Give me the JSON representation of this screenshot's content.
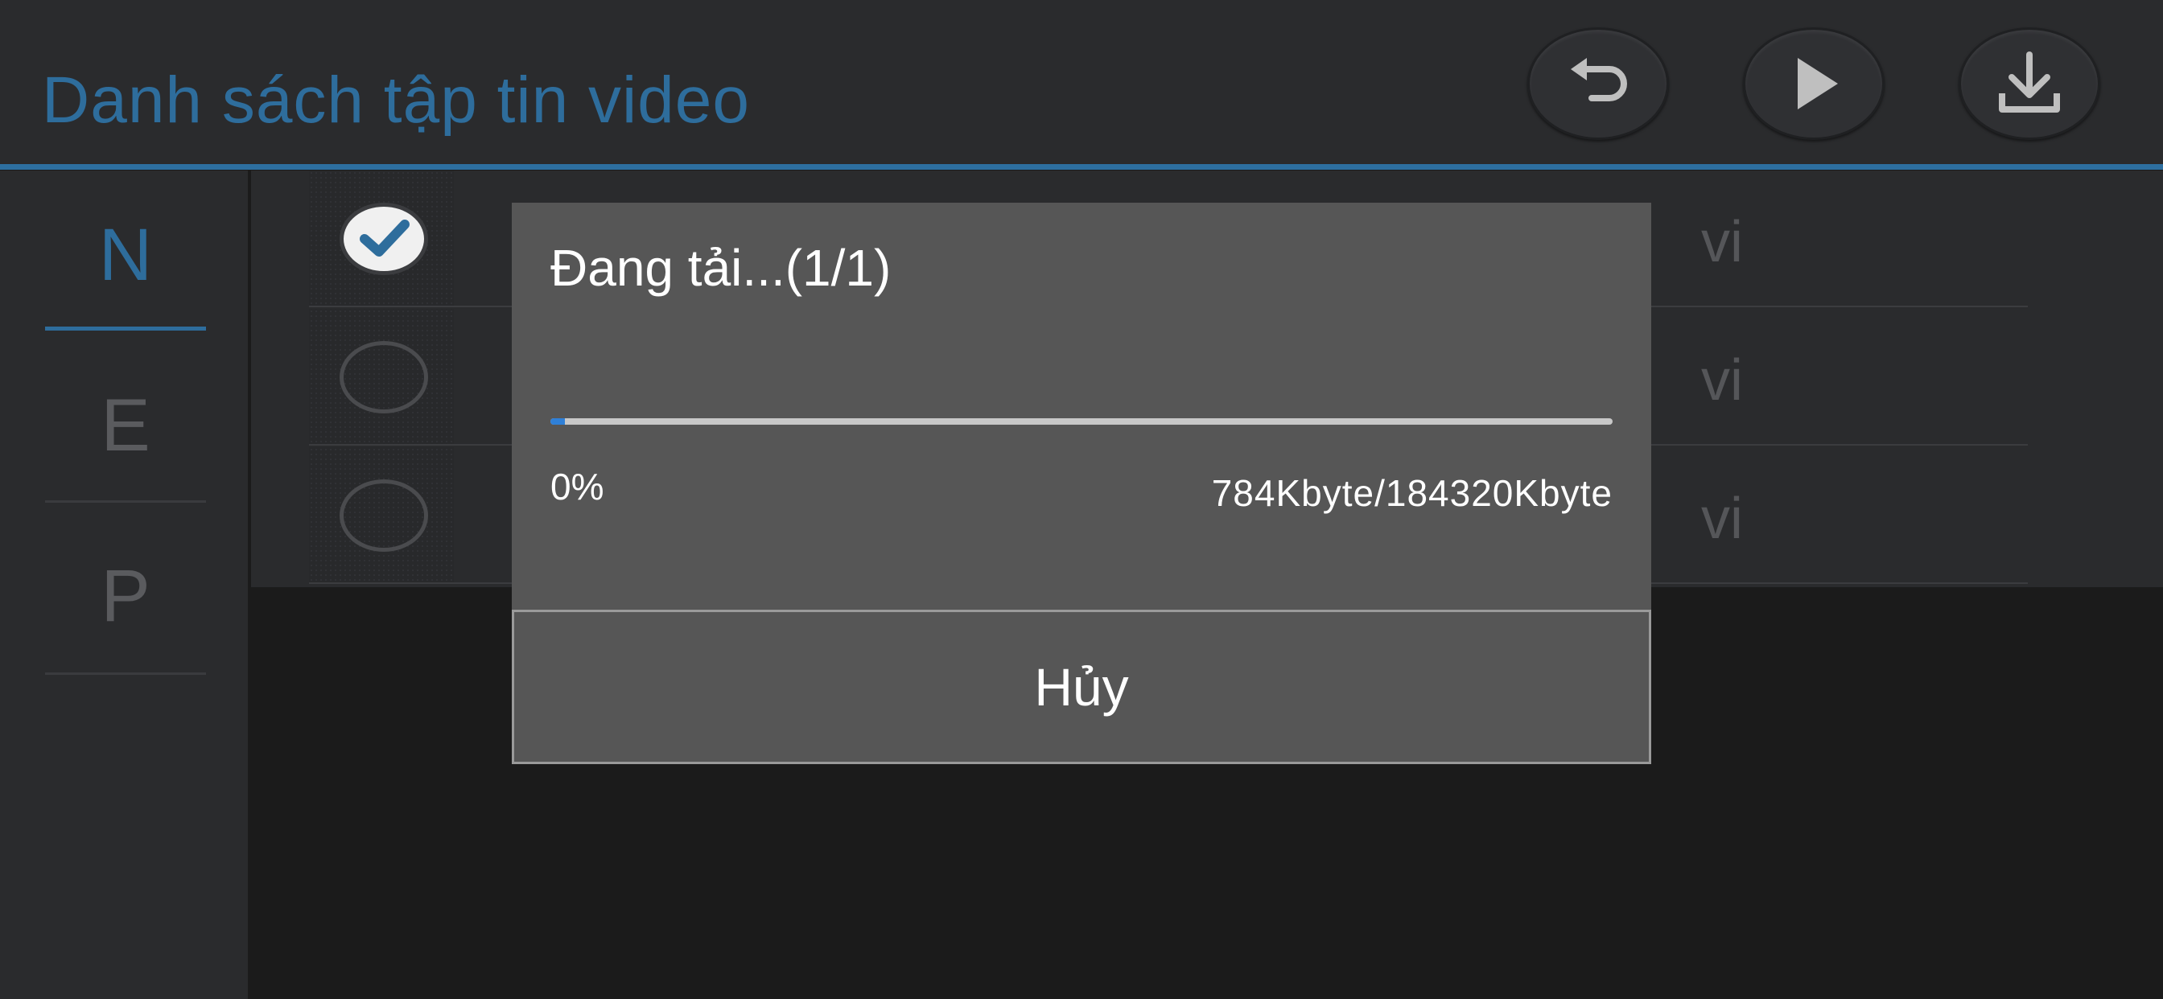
{
  "header": {
    "title": "Danh sách tập tin video",
    "buttons": [
      {
        "icon": "back-arrow-icon"
      },
      {
        "icon": "play-icon"
      },
      {
        "icon": "download-icon"
      }
    ]
  },
  "sidebar": {
    "items": [
      {
        "label": "N",
        "active": true
      },
      {
        "label": "E",
        "active": false
      },
      {
        "label": "P",
        "active": false
      }
    ]
  },
  "list": {
    "rows": [
      {
        "checked": true,
        "ext_fragment": "vi"
      },
      {
        "checked": false,
        "ext_fragment": "vi"
      },
      {
        "checked": false,
        "ext_fragment": "vi"
      }
    ]
  },
  "dialog": {
    "title": "Đang tải...(1/1)",
    "progress_percent": 0,
    "progress_fraction": 0.0043,
    "percent_label": "0%",
    "size_label": "784Kbyte/184320Kbyte",
    "cancel_label": "Hủy"
  },
  "colors": {
    "accent": "#2e6d9c",
    "progress": "#2f80d8",
    "dialog_bg": "#565656"
  }
}
